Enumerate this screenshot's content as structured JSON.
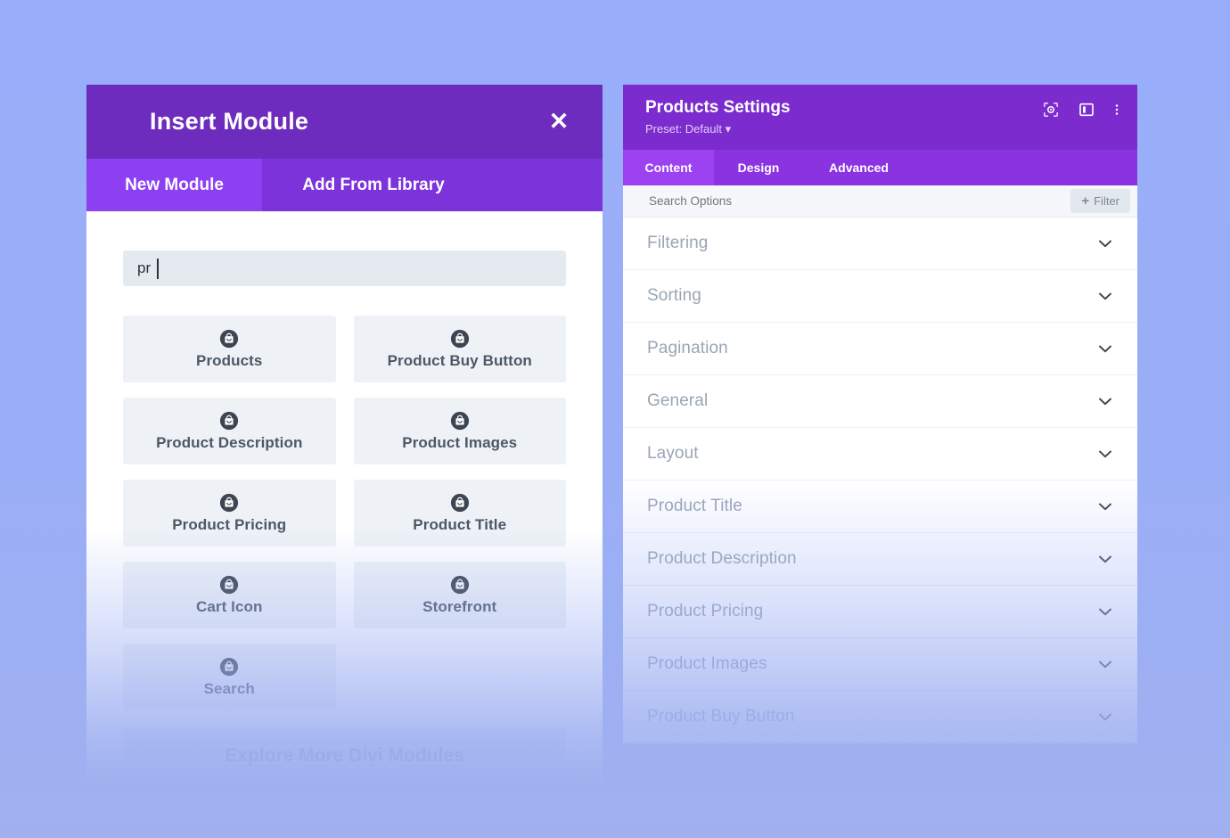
{
  "insert_module": {
    "title": "Insert Module",
    "close_icon": "close-x-icon",
    "tabs": [
      {
        "label": "New Module",
        "active": true
      },
      {
        "label": "Add From Library",
        "active": false
      }
    ],
    "search": {
      "value": "pr",
      "placeholder": ""
    },
    "modules": [
      {
        "label": "Products",
        "icon": "shopping-bag-icon"
      },
      {
        "label": "Product Buy Button",
        "icon": "shopping-bag-icon"
      },
      {
        "label": "Product Description",
        "icon": "shopping-bag-icon"
      },
      {
        "label": "Product Images",
        "icon": "shopping-bag-icon"
      },
      {
        "label": "Product Pricing",
        "icon": "shopping-bag-icon"
      },
      {
        "label": "Product Title",
        "icon": "shopping-bag-icon"
      },
      {
        "label": "Cart Icon",
        "icon": "shopping-bag-icon"
      },
      {
        "label": "Storefront",
        "icon": "shopping-bag-icon"
      },
      {
        "label": "Search",
        "icon": "shopping-bag-icon"
      }
    ],
    "explore_button": "Explore More Divi Modules"
  },
  "products_settings": {
    "title": "Products Settings",
    "preset": "Preset: Default",
    "header_icons": [
      "target-focus-icon",
      "panel-layout-icon",
      "kebab-menu-icon"
    ],
    "tabs": [
      {
        "label": "Content",
        "active": true
      },
      {
        "label": "Design",
        "active": false
      },
      {
        "label": "Advanced",
        "active": false
      }
    ],
    "search_options": {
      "placeholder": "Search Options",
      "value": "",
      "filter_label": "Filter",
      "filter_plus": "+"
    },
    "sections": [
      {
        "label": "Filtering"
      },
      {
        "label": "Sorting"
      },
      {
        "label": "Pagination"
      },
      {
        "label": "General"
      },
      {
        "label": "Layout"
      },
      {
        "label": "Product Title"
      },
      {
        "label": "Product Description"
      },
      {
        "label": "Product Pricing"
      },
      {
        "label": "Product Images"
      },
      {
        "label": "Product Buy Button"
      }
    ]
  },
  "colors": {
    "background": "#9aaef8",
    "insert_titlebar": "#6d2cbd",
    "insert_tabbar": "#7c33da",
    "insert_tab_active": "#8d3ff2",
    "settings_titlebar": "#7b2bce",
    "settings_tabbar": "#8b33e0",
    "settings_tab_active": "#9d42f0",
    "card_background": "#eef2f6",
    "card_label": "#4c5866",
    "section_label": "#9aa5b4"
  }
}
